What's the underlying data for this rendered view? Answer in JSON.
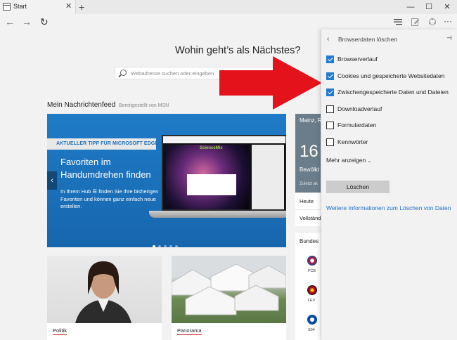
{
  "tab": {
    "label": "Start",
    "close": "✕",
    "new_tab": "+"
  },
  "window_controls": {
    "minimize": "—",
    "maximize": "☐",
    "close": "✕"
  },
  "nav": {
    "back": "←",
    "forward": "→",
    "refresh": "↻",
    "more": "···"
  },
  "page": {
    "heading": "Wohin geht’s als Nächstes?",
    "search_placeholder": "Webadresse suchen oder eingeben",
    "feed_title": "Mein Nachrichtenfeed",
    "feed_subtitle": "Bereitgestellt von MSN"
  },
  "hero": {
    "tip_label": "AKTUELLER TIPP FÜR MICROSOFT EDGE",
    "title": "Favoriten im Handumdrehen finden",
    "body": "In Ihrem Hub ☰ finden Sie Ihre bisherigen Favoriten und können ganz einfach neue erstellen.",
    "screen_logo": "ScienceMic",
    "prev": "‹",
    "next": "›",
    "slide_count": 5,
    "active_slide": 1
  },
  "weather": {
    "city": "Mainz, R",
    "temp": "16",
    "condition": "Bewölkt",
    "updated": "Zuletzt ak",
    "row_today": "Heute",
    "row_forecast": "Vollständ"
  },
  "league": {
    "title": "Bundes",
    "teams": [
      "FCB",
      "LEV",
      "S04"
    ]
  },
  "cards": [
    {
      "category": "Politik"
    },
    {
      "category": "Panorama"
    }
  ],
  "panel": {
    "back": "‹",
    "title": "Browserdaten löschen",
    "pin": "⊣",
    "options": [
      {
        "label": "Browserverlauf",
        "checked": true
      },
      {
        "label": "Cookies und gespeicherte Websitedaten",
        "checked": true
      },
      {
        "label": "Zwischengespeicherte Daten und Dateien",
        "checked": true
      },
      {
        "label": "Downloadverlauf",
        "checked": false
      },
      {
        "label": "Formulardaten",
        "checked": false
      },
      {
        "label": "Kennwörter",
        "checked": false
      }
    ],
    "show_more": "Mehr anzeigen",
    "clear_button": "Löschen",
    "more_info_link": "Weitere Informationen zum Löschen von Daten"
  },
  "colors": {
    "accent": "#1f7bd3",
    "hero_blue": "#1a6fb8",
    "arrow_red": "#e3121b",
    "weather_bg": "#6b7d8a"
  }
}
